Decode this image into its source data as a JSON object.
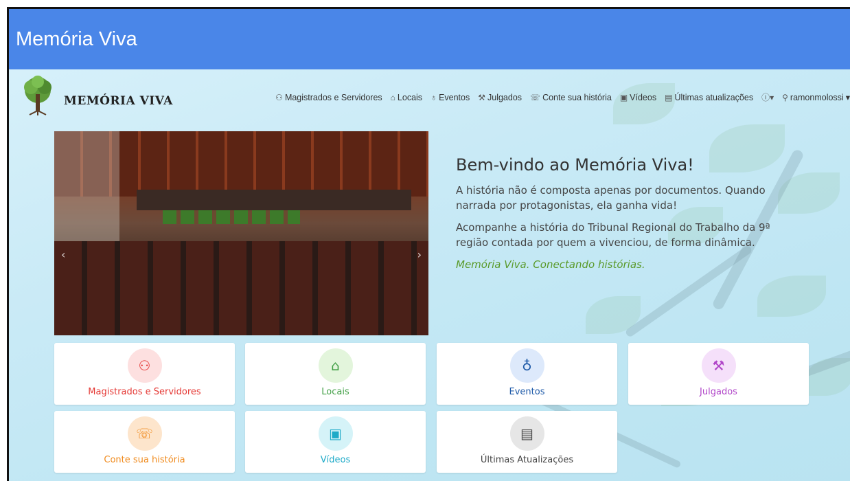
{
  "window": {
    "title": "Memória Viva"
  },
  "brand": {
    "name": "MEMÓRIA VIVA"
  },
  "nav": {
    "items": [
      {
        "icon": "people-icon",
        "glyph": "⚇",
        "label": "Magistrados e Servidores"
      },
      {
        "icon": "building-icon",
        "glyph": "⌂",
        "label": "Locais"
      },
      {
        "icon": "ribbon-icon",
        "glyph": "♁",
        "label": "Eventos"
      },
      {
        "icon": "gavel-icon",
        "glyph": "⚒",
        "label": "Julgados"
      },
      {
        "icon": "chat-icon",
        "glyph": "☏",
        "label": "Conte sua história"
      },
      {
        "icon": "video-icon",
        "glyph": "▣",
        "label": "Vídeos"
      },
      {
        "icon": "list-icon",
        "glyph": "▤",
        "label": "Últimas atualizações"
      }
    ],
    "info": "ⓘ▾",
    "user": "ramonmolossi"
  },
  "welcome": {
    "heading": "Bem-vindo ao Memória Viva!",
    "p1": "A história não é composta apenas por documentos. Quando narrada por protagonistas, ela ganha vida!",
    "p2": "Acompanhe a história do Tribunal Regional do Trabalho da 9ª região contada por quem a vivenciou, de forma dinâmica.",
    "tagline": "Memória Viva. Conectando histórias."
  },
  "cards": [
    {
      "label": "Magistrados e Servidores",
      "icon": "people-icon",
      "glyph": "⚇",
      "color": "#e53935",
      "bg": "#fde0e0"
    },
    {
      "label": "Locais",
      "icon": "building-icon",
      "glyph": "⌂",
      "color": "#43a047",
      "bg": "#e3f5dc"
    },
    {
      "label": "Eventos",
      "icon": "ribbon-icon",
      "glyph": "♁",
      "color": "#1e5aa8",
      "bg": "#dde9fb"
    },
    {
      "label": "Julgados",
      "icon": "gavel-icon",
      "glyph": "⚒",
      "color": "#b044c8",
      "bg": "#f5e0fa"
    },
    {
      "label": "Conte sua história",
      "icon": "chat-icon",
      "glyph": "☏",
      "color": "#f08a1c",
      "bg": "#fde5cc"
    },
    {
      "label": "Vídeos",
      "icon": "video-icon",
      "glyph": "▣",
      "color": "#1eaac8",
      "bg": "#d5f3f8"
    },
    {
      "label": "Últimas Atualizações",
      "icon": "list-icon",
      "glyph": "▤",
      "color": "#444444",
      "bg": "#e6e6e6"
    }
  ]
}
